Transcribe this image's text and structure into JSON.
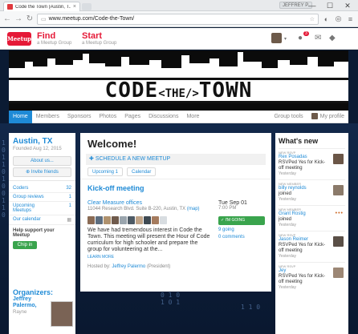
{
  "browser": {
    "tab_title": "Code the Town (Austin, T...",
    "user_chip": "JEFFREY P.",
    "url": "www.meetup.com/Code-the-Town/",
    "window_buttons": [
      "—",
      "☐",
      "✕"
    ]
  },
  "header": {
    "logo": "Meetup",
    "find_label": "Find",
    "find_sub": "a Meetup Group",
    "start_label": "Start",
    "start_sub": "a Meetup Group",
    "notification_count": "3"
  },
  "banner": {
    "title_a": "CODE",
    "title_b": "<THE/>",
    "title_c": "TOWN"
  },
  "group_nav": {
    "items": [
      "Home",
      "Members",
      "Sponsors",
      "Photos",
      "Pages",
      "Discussions",
      "More"
    ],
    "tools": "Group tools",
    "profile": "My profile"
  },
  "left": {
    "city": "Austin, TX",
    "founded": "Founded Aug 12, 2015",
    "about": "About us...",
    "invite": "Invite friends",
    "rows": [
      {
        "label": "Coders",
        "count": "32"
      },
      {
        "label": "Group reviews",
        "count": "1"
      },
      {
        "label": "Upcoming Meetups",
        "count": "1"
      },
      {
        "label": "Our calendar",
        "count": ""
      }
    ],
    "support": "Help support your Meetup",
    "chip_in": "Chip in",
    "organizers_title": "Organizers:",
    "organizer_name": "Jeffrey Palermo,",
    "organizer_extra": "Rayne"
  },
  "main": {
    "welcome": "Welcome!",
    "schedule": "SCHEDULE A NEW MEETUP",
    "tabs": [
      "Upcoming 1",
      "Calendar"
    ],
    "event_title": "Kick-off meeting",
    "venue": "Clear Measure offices",
    "address": "11044 Research Blvd. Suite B-220, Austin, TX",
    "map": "(map)",
    "description": "We have had tremendous interest in Code the Town. This meeting will present the Hour of Code curriculum for high schooler and prepare the group for volunteering at the...",
    "learn_more": "LEARN MORE",
    "hosted_prefix": "Hosted by:",
    "host": "Jeffrey Palermo",
    "host_role": "(President)",
    "date": "Tue Sep 01",
    "time": "7:00 PM",
    "going_button": "✓ I'M GOING",
    "going_count": "9",
    "going_label": "going",
    "comments_count": "0",
    "comments_label": "comments"
  },
  "whats_new": {
    "title": "What's new",
    "items": [
      {
        "kind": "NEW RSVP",
        "who": "Rex Posadas",
        "what": "RSVPed Yes for Kick-off meeting",
        "when": "Yesterday"
      },
      {
        "kind": "NEW MEMBER",
        "who": "billy reynolds",
        "what": "joined",
        "when": "Yesterday"
      },
      {
        "kind": "NEW MEMBER",
        "who": "Grant Rostig",
        "what": "joined",
        "when": "Yesterday"
      },
      {
        "kind": "NEW RSVP",
        "who": "Jason Reimer",
        "what": "RSVPed Yes for Kick-off meeting",
        "when": "Yesterday"
      },
      {
        "kind": "NEW RSVP",
        "who": "Jey",
        "what": "RSVPed Yes for Kick-off meeting",
        "when": "Yesterday"
      }
    ]
  },
  "colors": {
    "brand": "#e51937",
    "link": "#1e8ad6",
    "go": "#3aa44d"
  }
}
